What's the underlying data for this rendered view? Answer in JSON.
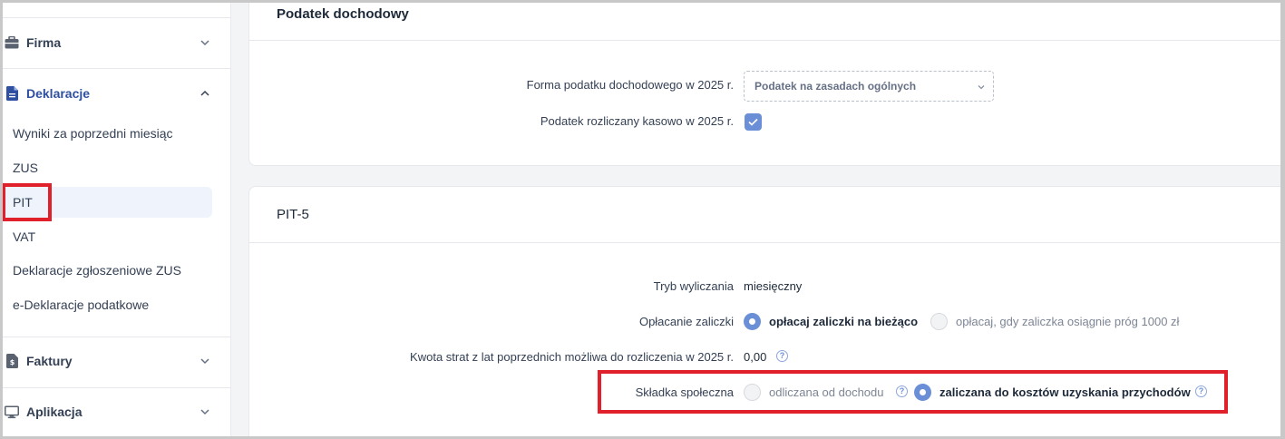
{
  "sidebar": {
    "sections": [
      {
        "label": "Firma",
        "icon": "briefcase-icon",
        "expanded": false
      },
      {
        "label": "Deklaracje",
        "icon": "document-icon",
        "expanded": true
      },
      {
        "label": "Faktury",
        "icon": "invoice-icon",
        "expanded": false
      },
      {
        "label": "Aplikacja",
        "icon": "monitor-icon",
        "expanded": false
      }
    ],
    "items": [
      {
        "label": "Wyniki za poprzedni miesiąc"
      },
      {
        "label": "ZUS"
      },
      {
        "label": "PIT",
        "selected": true
      },
      {
        "label": "VAT"
      },
      {
        "label": "Deklaracje zgłoszeniowe ZUS"
      },
      {
        "label": "e-Deklaracje podatkowe"
      }
    ]
  },
  "income_tax": {
    "title": "Podatek dochodowy",
    "form_label": "Forma podatku dochodowego w 2025 r.",
    "form_value": "Podatek na zasadach ogólnych",
    "cash_label": "Podatek rozliczany kasowo w 2025 r.",
    "cash_checked": true
  },
  "pit5": {
    "title": "PIT-5",
    "mode_label": "Tryb wyliczania",
    "mode_value": "miesięczny",
    "payment_label": "Opłacanie zaliczki",
    "payment_options": [
      {
        "label": "opłacaj zaliczki na bieżąco",
        "selected": true
      },
      {
        "label": "opłacaj, gdy zaliczka osiągnie próg 1000 zł",
        "selected": false
      }
    ],
    "loss_label": "Kwota strat z lat poprzednich możliwa do rozliczenia w 2025 r.",
    "loss_value": "0,00",
    "social_label": "Składka społeczna",
    "social_options": [
      {
        "label": "odliczana od dochodu",
        "selected": false
      },
      {
        "label": "zaliczana do kosztów uzyskania przychodów",
        "selected": true
      }
    ],
    "help_glyph": "?"
  },
  "colors": {
    "accent": "#6b8fd6",
    "active_section": "#2f4fa0",
    "selected_item_bg": "#eef3fc",
    "highlight": "#e0202a"
  }
}
